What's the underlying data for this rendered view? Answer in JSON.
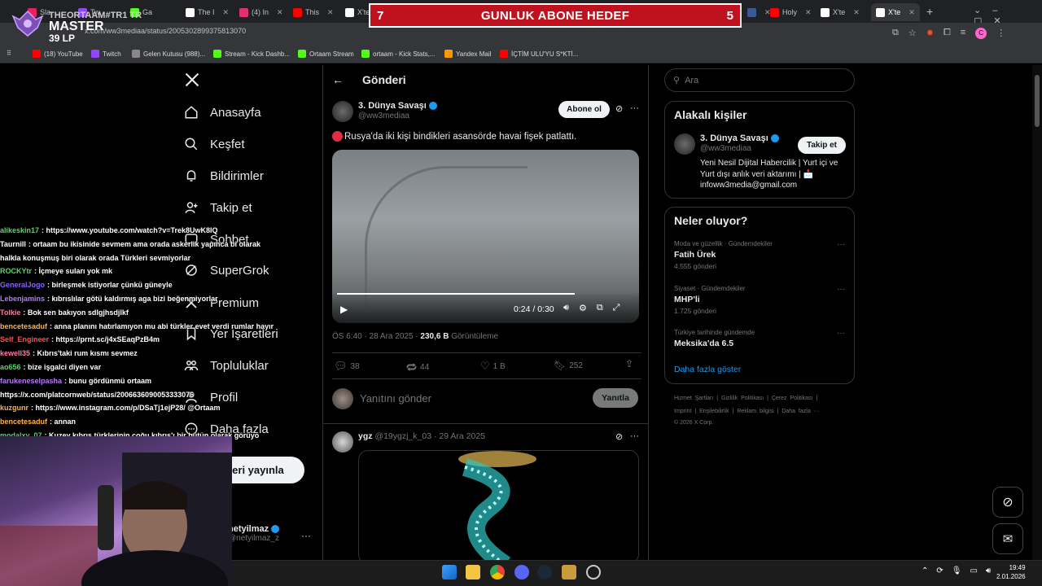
{
  "browser": {
    "tabs": [
      {
        "label": "Sla",
        "color": "#e91e63"
      },
      {
        "label": "Tw",
        "color": "#9146ff"
      },
      {
        "label": "Ga",
        "color": "#53fc18"
      },
      {
        "label": "The I",
        "color": "#ffffff"
      },
      {
        "label": "(4) In",
        "color": "#e1306c"
      },
      {
        "label": "This",
        "color": "#ff0000"
      },
      {
        "label": "X'te",
        "color": "#ffffff"
      },
      {
        "label": "",
        "color": "#3b5998"
      },
      {
        "label": "Holy",
        "color": "#ff0000"
      },
      {
        "label": "X'te",
        "color": "#ffffff"
      },
      {
        "label": "X'te",
        "color": "#ffffff"
      }
    ],
    "url": "x.com/ww3mediaa/status/2005302899375813070",
    "bookmarks": [
      {
        "label": "(18) YouTube",
        "color": "#ff0000"
      },
      {
        "label": "Twitch",
        "color": "#9146ff"
      },
      {
        "label": "Gelen Kutusu (988)...",
        "color": "#888888"
      },
      {
        "label": "Stream - Kick Dashb...",
        "color": "#53fc18"
      },
      {
        "label": "Ortaam Stream",
        "color": "#53fc18"
      },
      {
        "label": "ortaam - Kick Stats,...",
        "color": "#53fc18"
      },
      {
        "label": "Yandex Mail",
        "color": "#ff9900"
      },
      {
        "label": "İÇTİM ULU'YU S*KTİ...",
        "color": "#ff0000"
      }
    ]
  },
  "overlay": {
    "goal_left": "7",
    "goal_title": "GUNLUK ABONE HEDEF",
    "goal_right": "5",
    "badge_line1": "THEORTAAM#TR1 TR",
    "badge_line2": "MASTER",
    "badge_line3": "39 LP"
  },
  "nav": {
    "anasayfa": "Anasayfa",
    "kesfet": "Keşfet",
    "bildirimler": "Bildirimler",
    "takipet": "Takip et",
    "sohbet": "Sohbet",
    "supergrok": "SuperGrok",
    "premium": "Premium",
    "yerisaretleri": "Yer İşaretleri",
    "topluluklar": "Topluluklar",
    "profil": "Profil",
    "dahafazla": "Daha fazla",
    "post_button": "Gönderi yayınla",
    "account_name": "netyilmaz",
    "account_handle": "@netyilmaz_z"
  },
  "post": {
    "header": "Gönderi",
    "author": "3. Dünya Savaşı",
    "handle": "@ww3mediaa",
    "subscribe": "Abone ol",
    "text": "Rusya'da iki kişi bindikleri asansörde havai fişek patlattı.",
    "video_time": "0:24 / 0:30",
    "video_progress": 0.8,
    "timestamp": "ÖS 6:40 · 28 Ara 2025 · ",
    "views": "230,6 B",
    "views_label": "Görüntüleme",
    "replies": "38",
    "reposts": "44",
    "likes": "1 B",
    "bookmarks": "252",
    "reply_placeholder": "Yanıtını gönder",
    "reply_button": "Yanıtla"
  },
  "reply": {
    "name": "ygz",
    "handle_date": "@19ygzj_k_03 · 29 Ara 2025"
  },
  "right": {
    "search_placeholder": "Ara",
    "related_title": "Alakalı kişiler",
    "related_name": "3. Dünya Savaşı",
    "related_handle": "@ww3mediaa",
    "follow": "Takip et",
    "related_bio": "Yeni Nesil Dijital Habercilik | Yurt içi ve Yurt dışı anlık veri aktarımı | 📩 infoww3media@gmail.com",
    "trends_title": "Neler oluyor?",
    "trends": [
      {
        "context": "Moda ve güzellik · Gündemdekiler",
        "topic": "Fatih Ürek",
        "count": "4.555 gönderi"
      },
      {
        "context": "Siyaset · Gündemdekiler",
        "topic": "MHP'li",
        "count": "1.725 gönderi"
      },
      {
        "context": "Türkiye tarihinde gündemde",
        "topic": "Meksika'da 6.5",
        "count": ""
      }
    ],
    "show_more": "Daha fazla göster",
    "footer1": "Hizmet Şartları  |  Gizlilik Politikası  |  Çerez Politikası  |",
    "footer2": "Imprint  |  Erişilebilirlik  |  Reklam bilgisi  |  Daha fazla ···",
    "footer3": "© 2026 X Corp."
  },
  "chat": [
    {
      "user": "alikeskin17",
      "color": "#5bd36a",
      "msg": ": https://www.youtube.com/watch?v=Trek8UwK8IQ"
    },
    {
      "user": "Taurnill",
      "color": "#ffffff",
      "msg": ": ortaam bu ikisinide sevmem ama orada askerlik yapınca bi olarak"
    },
    {
      "user": "",
      "color": "#ffffff",
      "msg": "halkla konuşmuş biri olarak orada Türkleri sevmiyorlar"
    },
    {
      "user": "ROCKYtr",
      "color": "#5bd36a",
      "msg": ": İçmeye suları yok mk"
    },
    {
      "user": "GeneralJogo",
      "color": "#8a63ff",
      "msg": ": birleşmek istiyorlar çünkü güneyle"
    },
    {
      "user": "Lebenjamins",
      "color": "#b679ff",
      "msg": ": kıbrıslılar götü kaldırmış aga bizi beğenmiyorlar"
    },
    {
      "user": "Tolkie",
      "color": "#ff7aa8",
      "msg": ": Bok sen bakıyon sdlgjhsdjlkf"
    },
    {
      "user": "bencetesaduf",
      "color": "#ffb347",
      "msg": ": anna planını hatırlamıyon mu abi türkler evet verdi rumlar hayır"
    },
    {
      "user": "Self_Engineer",
      "color": "#ff4d4d",
      "msg": ": https://prnt.sc/j4xSEaqPzB4m"
    },
    {
      "user": "kewell35",
      "color": "#ff7aa8",
      "msg": ": Kıbrıs'taki rum kısmı sevmez"
    },
    {
      "user": "ao656",
      "color": "#5bd36a",
      "msg": ": bize işgalci diyen var"
    },
    {
      "user": "farukeneselpasha",
      "color": "#b679ff",
      "msg": ": bunu gördünmü ortaam"
    },
    {
      "user": "",
      "color": "#ffffff",
      "msg": "https://x.com/platcornweb/status/2006636090053333076"
    },
    {
      "user": "kuzgunr",
      "color": "#ffb347",
      "msg": ": https://www.instagram.com/p/DSaTj1ejP28/ @Ortaam"
    },
    {
      "user": "bencetesaduf",
      "color": "#ffb347",
      "msg": ": annan"
    },
    {
      "user": "modalxy_07",
      "color": "#5bd36a",
      "msg": ": Kuzey kıbrıs türklerinin çoğu kıbrıs'ı bir bütün olarak görüyo"
    }
  ],
  "taskbar": {
    "time": "19:49",
    "date": "2.01.2026"
  }
}
